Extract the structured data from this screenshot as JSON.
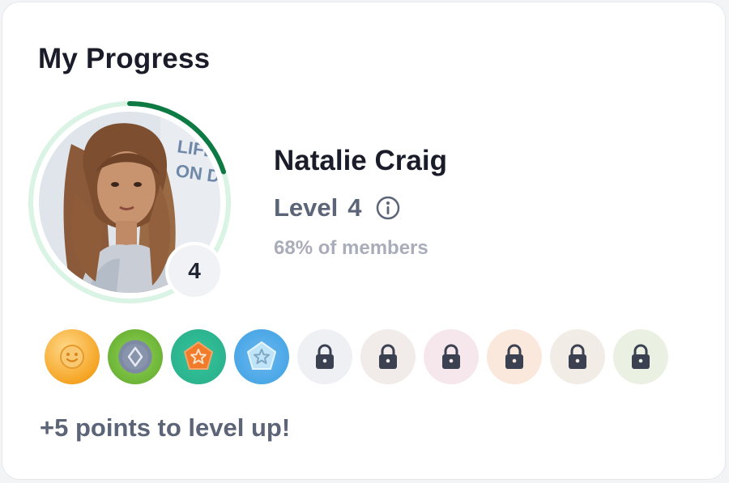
{
  "card": {
    "title": "My Progress"
  },
  "profile": {
    "name": "Natalie Craig",
    "level_label": "Level",
    "level_value": "4",
    "badge_level": "4",
    "members_text": "68% of members",
    "progress_fraction": 0.2,
    "photo_sign_text": "LIFEG ON DUT"
  },
  "badges": [
    {
      "name": "smiley-badge",
      "state": "unlocked",
      "color": "#f5a524"
    },
    {
      "name": "diamond-badge",
      "state": "unlocked",
      "color": "#7ac142"
    },
    {
      "name": "pentagon-star-badge",
      "state": "unlocked",
      "color": "#2bb48f"
    },
    {
      "name": "star-shield-badge",
      "state": "unlocked",
      "color": "#4ba7e6"
    },
    {
      "name": "lock-icon",
      "state": "locked",
      "color": "#eef0f3"
    },
    {
      "name": "lock-icon",
      "state": "locked",
      "color": "#f1ebea"
    },
    {
      "name": "lock-icon",
      "state": "locked",
      "color": "#f6e7ec"
    },
    {
      "name": "lock-icon",
      "state": "locked",
      "color": "#fbe8dc"
    },
    {
      "name": "lock-icon",
      "state": "locked",
      "color": "#f1ede6"
    },
    {
      "name": "lock-icon",
      "state": "locked",
      "color": "#eaf1e2"
    }
  ],
  "footer": {
    "points_text": "+5 points to level up!"
  },
  "colors": {
    "ring_track": "#d9f3e4",
    "ring_progress": "#0e7a43",
    "text_primary": "#1a1d29",
    "text_secondary": "#5c6478",
    "text_muted": "#a9adb9",
    "lock_icon": "#3b4150"
  }
}
